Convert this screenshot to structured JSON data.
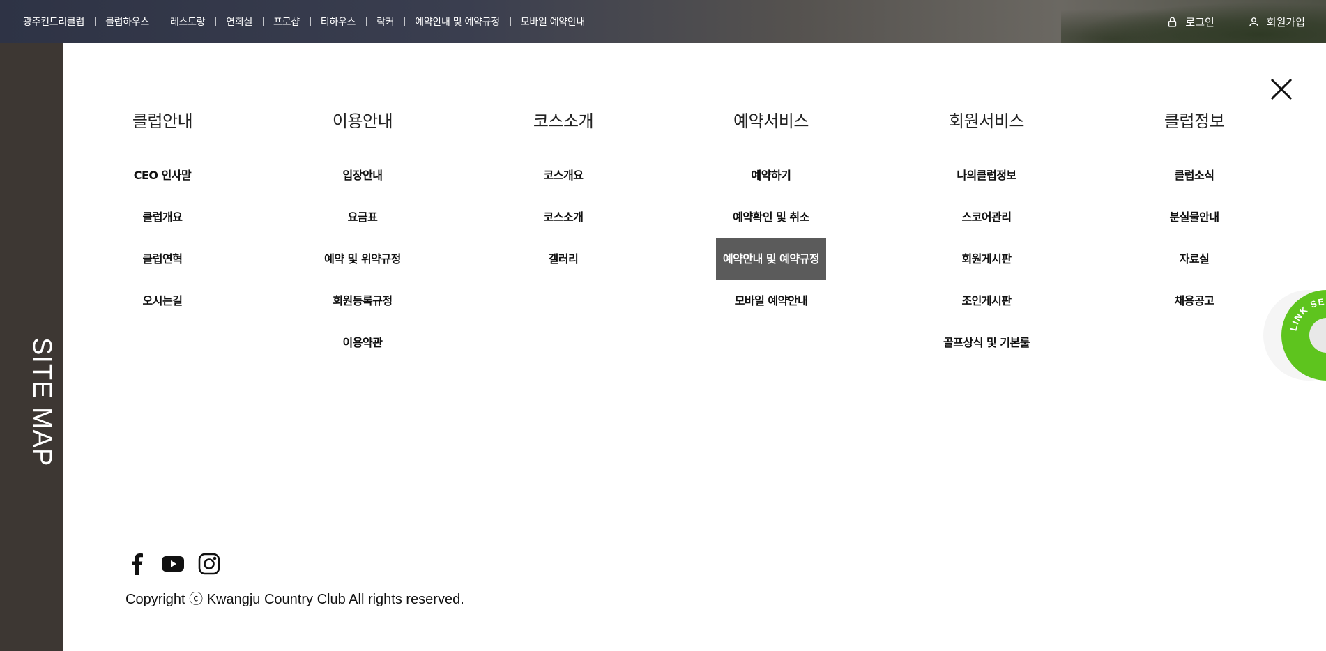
{
  "topnav": {
    "items": [
      "광주컨트리클럽",
      "클럽하우스",
      "레스토랑",
      "연회실",
      "프로샵",
      "티하우스",
      "락커",
      "예약안내 및 예약규정",
      "모바일 예약안내"
    ],
    "login": "로그인",
    "signup": "회원가입"
  },
  "sidebar": {
    "label": "SITE MAP"
  },
  "sitemap": {
    "columns": [
      {
        "title": "클럽안내",
        "links": [
          "CEO 인사말",
          "클럽개요",
          "클럽연혁",
          "오시는길"
        ]
      },
      {
        "title": "이용안내",
        "links": [
          "입장안내",
          "요금표",
          "예약 및 위약규정",
          "회원등록규정",
          "이용약관"
        ]
      },
      {
        "title": "코스소개",
        "links": [
          "코스개요",
          "코스소개",
          "갤러리"
        ]
      },
      {
        "title": "예약서비스",
        "links": [
          "예약하기",
          "예약확인 및 취소",
          "예약안내 및 예약규정",
          "모바일 예약안내"
        ],
        "active_index": 2
      },
      {
        "title": "회원서비스",
        "links": [
          "나의클럽정보",
          "스코어관리",
          "회원게시판",
          "조인게시판",
          "골프상식 및 기본룰"
        ]
      },
      {
        "title": "클럽정보",
        "links": [
          "클럽소식",
          "분실물안내",
          "자료실",
          "채용공고"
        ]
      }
    ]
  },
  "footer": {
    "social": [
      "facebook-icon",
      "youtube-icon",
      "instagram-icon"
    ],
    "copyright": "Copyright ⓒ Kwangju Country Club All rights reserved."
  },
  "link_service": {
    "label": "LINK SERVICE",
    "color": "#5ec41e"
  },
  "colors": {
    "active_bg": "#5b5b5b",
    "sidebar_bg": "#3d3733"
  }
}
